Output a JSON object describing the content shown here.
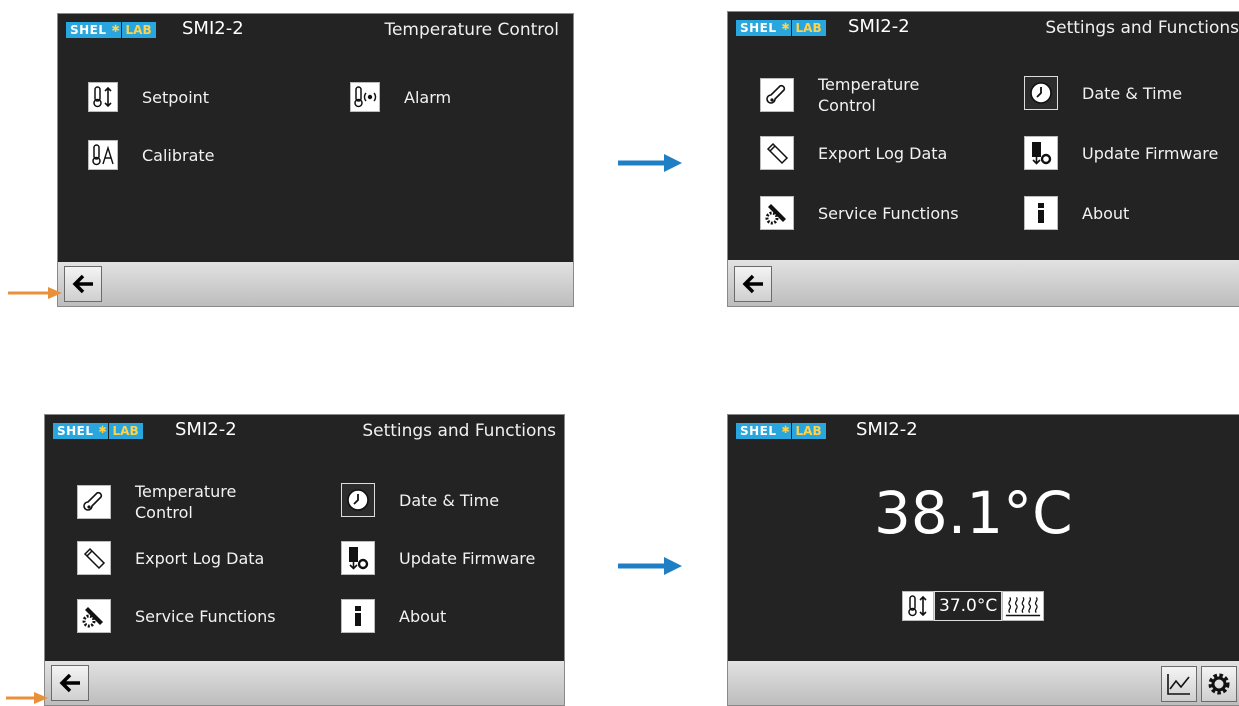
{
  "brand": {
    "shel": "SHEL",
    "lab": "LAB",
    "model": "SMI2-2"
  },
  "screens": {
    "temp_control": {
      "title": "Temperature Control",
      "items": [
        {
          "label": "Setpoint",
          "icon": "thermometer-updown-icon"
        },
        {
          "label": "Alarm",
          "icon": "thermometer-alarm-icon"
        },
        {
          "label": "Calibrate",
          "icon": "thermometer-calibrate-icon"
        }
      ]
    },
    "settings_a": {
      "title": "Settings and Functions",
      "items": [
        {
          "label_1": "Temperature",
          "label_2": "Control",
          "icon": "thermometer-icon"
        },
        {
          "label": "Date & Time",
          "icon": "clock-icon"
        },
        {
          "label": "Export Log Data",
          "icon": "usb-icon"
        },
        {
          "label": "Update Firmware",
          "icon": "firmware-icon"
        },
        {
          "label": "Service Functions",
          "icon": "wrench-gear-icon"
        },
        {
          "label": "About",
          "icon": "info-icon"
        }
      ]
    },
    "settings_b": {
      "title": "Settings and Functions",
      "items": [
        {
          "label_1": "Temperature",
          "label_2": "Control",
          "icon": "thermometer-icon"
        },
        {
          "label": "Date & Time",
          "icon": "clock-icon"
        },
        {
          "label": "Export Log Data",
          "icon": "usb-icon"
        },
        {
          "label": "Update Firmware",
          "icon": "firmware-icon"
        },
        {
          "label": "Service Functions",
          "icon": "wrench-gear-icon"
        },
        {
          "label": "About",
          "icon": "info-icon"
        }
      ]
    },
    "home": {
      "temperature": "38.1°C",
      "setpoint": "37.0°C"
    }
  },
  "colors": {
    "screen_bg": "#232323",
    "arrow_blue": "#1f7fc4",
    "arrow_orange": "#e8913a",
    "logo_blue": "#2aa6de",
    "logo_yellow": "#ffd24a"
  }
}
